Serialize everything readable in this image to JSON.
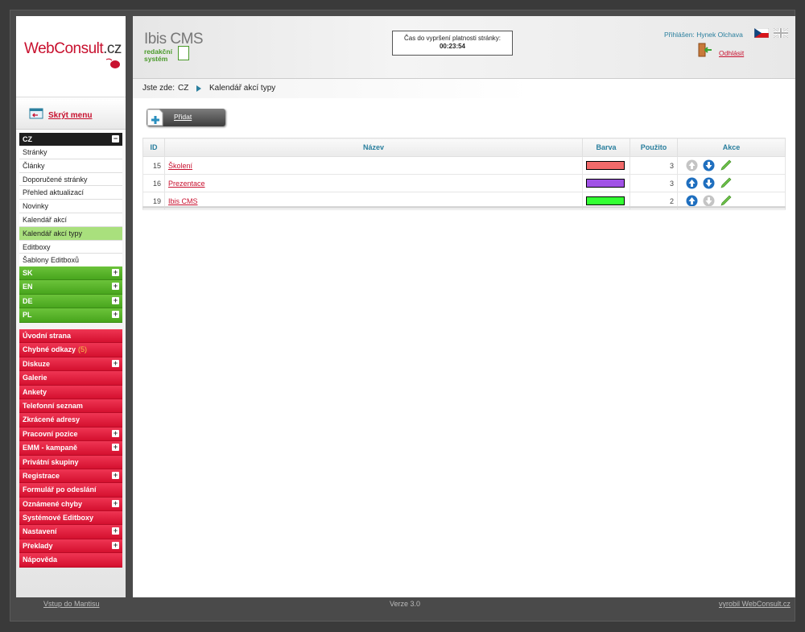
{
  "brand": {
    "logo_main": "WebConsult",
    "logo_tld": ".cz"
  },
  "sidebar": {
    "hide_menu": "Skrýt menu",
    "lang_cz": "CZ",
    "cz_items": [
      "Stránky",
      "Články",
      "Doporučené stránky",
      "Přehled aktualizací",
      "Novinky",
      "Kalendář akcí",
      "Kalendář akcí typy",
      "Editboxy",
      "Šablony Editboxů"
    ],
    "active_item": "Kalendář akcí typy",
    "languages": [
      "SK",
      "EN",
      "DE",
      "PL"
    ],
    "modules": [
      {
        "label": "Úvodní strana",
        "expand": false
      },
      {
        "label": "Chybné odkazy",
        "badge": "(5)",
        "expand": false
      },
      {
        "label": "Diskuze",
        "expand": true
      },
      {
        "label": "Galerie",
        "expand": false
      },
      {
        "label": "Ankety",
        "expand": false
      },
      {
        "label": "Telefonní seznam",
        "expand": false
      },
      {
        "label": "Zkrácené adresy",
        "expand": false
      },
      {
        "label": "Pracovní pozice",
        "expand": true
      },
      {
        "label": "EMM - kampaně",
        "expand": true
      },
      {
        "label": "Privátní skupiny",
        "expand": false
      },
      {
        "label": "Registrace",
        "expand": true
      },
      {
        "label": "Formulář po odeslání",
        "expand": false
      },
      {
        "label": "Oznámené chyby",
        "expand": true
      },
      {
        "label": "Systémové Editboxy",
        "expand": false
      },
      {
        "label": "Nastavení",
        "expand": true
      },
      {
        "label": "Překlady",
        "expand": true
      },
      {
        "label": "Nápověda",
        "expand": false
      }
    ]
  },
  "header": {
    "product": "Ibis CMS",
    "product_sub1": "redakční",
    "product_sub2": "systém",
    "timer_label": "Čas do vypršení platnosti stránky:",
    "timer_value": "00:23:54",
    "logged_label": "Přihlášen:",
    "logged_user": "Hynek Olchava",
    "logout": "Odhlásit"
  },
  "breadcrumb": {
    "prefix": "Jste zde:",
    "level1": "CZ",
    "level2": "Kalendář akcí typy"
  },
  "toolbar": {
    "add_label": "Přidat"
  },
  "table": {
    "headers": {
      "id": "ID",
      "name": "Název",
      "color": "Barva",
      "used": "Použito",
      "actions": "Akce"
    },
    "rows": [
      {
        "id": "15",
        "name": "Školení",
        "color": "#f26a6a",
        "used": "3",
        "up_enabled": false,
        "down_enabled": true
      },
      {
        "id": "16",
        "name": "Prezentace",
        "color": "#a152e6",
        "used": "3",
        "up_enabled": true,
        "down_enabled": true
      },
      {
        "id": "19",
        "name": "Ibis CMS",
        "color": "#33ff33",
        "used": "2",
        "up_enabled": true,
        "down_enabled": false
      }
    ]
  },
  "footer": {
    "left": "Vstup do Mantisu",
    "center": "Verze 3.0",
    "right": "vyrobil WebConsult.cz"
  },
  "colors": {
    "accent_red": "#c8102e",
    "accent_green": "#48a51d",
    "accent_blue": "#2a7f9e"
  }
}
